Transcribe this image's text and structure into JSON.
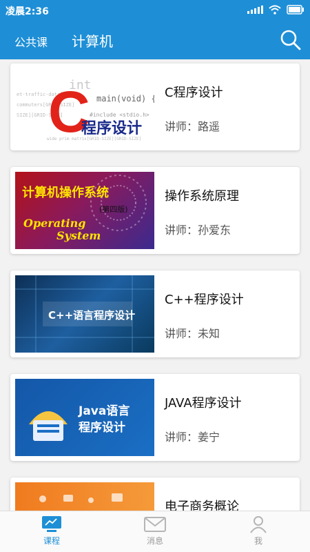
{
  "status": {
    "time": "凌晨2:36"
  },
  "appbar": {
    "left_tab": "公共课",
    "title": "计算机"
  },
  "courses": [
    {
      "title": "C程序设计",
      "lecturer": "讲师：路遥",
      "thumb": {
        "big_letter": "C",
        "caption": "程序设计",
        "code_left": "int",
        "code_right": "main(void) {",
        "code_include": "#include <stdio.h>"
      }
    },
    {
      "title": "操作系统原理",
      "lecturer": "讲师：孙爱东",
      "thumb": {
        "caption": "计算机操作系统",
        "edition": "(第四版)",
        "en1": "Operating",
        "en2": "System"
      }
    },
    {
      "title": "C++程序设计",
      "lecturer": "讲师：未知",
      "thumb": {
        "caption": "C++语言程序设计"
      }
    },
    {
      "title": "JAVA程序设计",
      "lecturer": "讲师：姜宁",
      "thumb": {
        "line1": "Java语言",
        "line2": "程序设计"
      }
    },
    {
      "title": "电子商务概论",
      "lecturer": ""
    }
  ],
  "tabs": [
    {
      "label": "课程",
      "icon": "monitor-icon",
      "active": true
    },
    {
      "label": "消息",
      "icon": "mail-icon",
      "active": false
    },
    {
      "label": "我",
      "icon": "user-icon",
      "active": false
    }
  ],
  "colors": {
    "primary": "#1e8fd6",
    "tab_active": "#1e8fd6",
    "tab_inactive": "#aaaaaa"
  }
}
